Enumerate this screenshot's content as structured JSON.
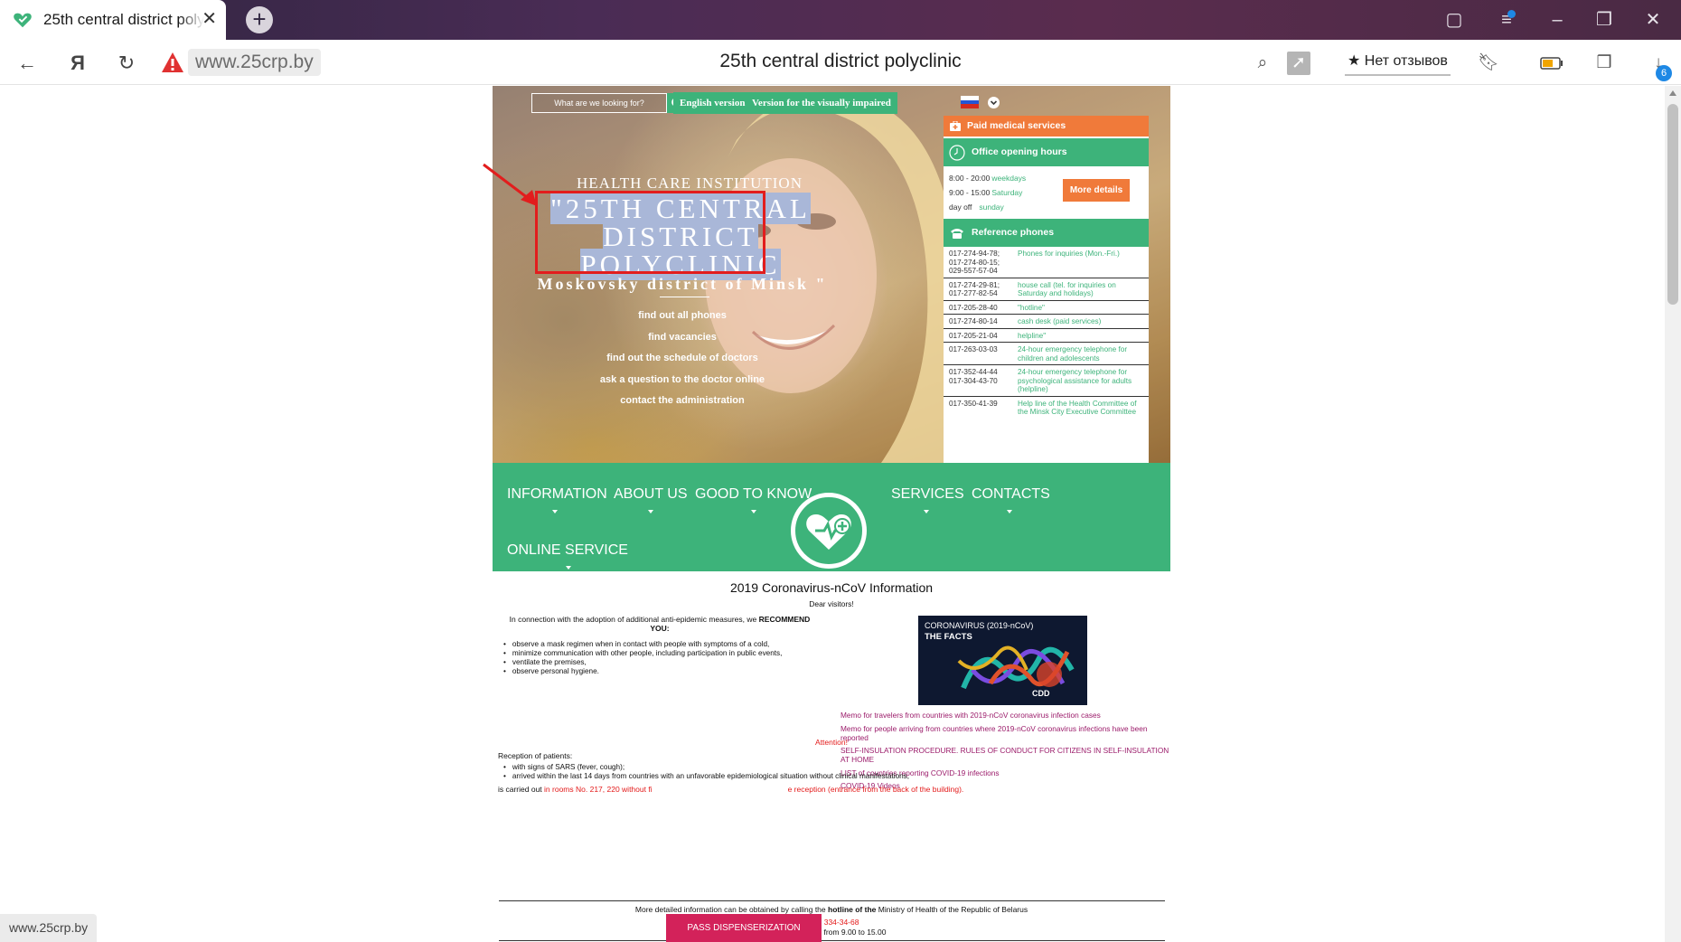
{
  "browser": {
    "tab_title": "25th central district polyclinic",
    "url": "www.25crp.by",
    "page_title": "25th central district polyclinic",
    "reviews_label": "Нет отзывов",
    "downloads_badge": "6",
    "status_url": "www.25crp.by"
  },
  "site": {
    "search_placeholder": "What are we looking for?",
    "english_btn": "English version",
    "visually_impaired_btn": "Version for the visually impaired",
    "hero": {
      "institution_label": "HEALTH CARE INSTITUTION",
      "name_line1": "\"25TH CENTRAL",
      "name_line2": "DISTRICT",
      "name_line3": "POLYCLINIC",
      "subname": "Moskovsky district of Minsk \"",
      "links": [
        "find out all phones",
        "find vacancies",
        "find out the schedule of doctors",
        "ask a question to the doctor online",
        "contact the administration"
      ]
    },
    "panel": {
      "paid_services": "Paid medical services",
      "office_hours_title": "Office opening hours",
      "hours": [
        {
          "time": "8:00 - 20:00",
          "label": "weekdays"
        },
        {
          "time": "9:00 - 15:00",
          "label": "Saturday"
        },
        {
          "time": "day off",
          "label": "sunday"
        }
      ],
      "more_details": "More details",
      "phones_title": "Reference phones",
      "phones": [
        {
          "num": "017-274-94-78;\n017-274-80-15;\n029-557-57-04",
          "desc": "Phones for inquiries (Mon.-Fri.)"
        },
        {
          "num": "017-274-29-81;\n017-277-82-54",
          "desc": "house call (tel. for inquiries on Saturday and holidays)"
        },
        {
          "num": "017-205-28-40",
          "desc": "\"hotline\""
        },
        {
          "num": "017-274-80-14",
          "desc": "cash desk (paid services)"
        },
        {
          "num": "017-205-21-04",
          "desc": "helpline\""
        },
        {
          "num": "017-263-03-03",
          "desc": "24-hour emergency telephone for children and adolescents"
        },
        {
          "num": "017-352-44-44\n017-304-43-70",
          "desc": "24-hour emergency telephone for psychological assistance for adults (helpline)"
        },
        {
          "num": "017-350-41-39",
          "desc": "Help line of the Health Committee of the Minsk City Executive Committee"
        }
      ]
    },
    "nav": {
      "information": "INFORMATION",
      "about_us": "ABOUT US",
      "good_to_know": "GOOD TO KNOW",
      "services": "SERVICES",
      "contacts": "CONTACTS",
      "online_service": "ONLINE SERVICE"
    },
    "content": {
      "title": "2019 Coronavirus-nCoV Information",
      "dear": "Dear visitors!",
      "para_pre": "In connection with the adoption of additional anti-epidemic measures, we",
      "para_bold": "RECOMMEND YOU:",
      "recommendations": [
        "observe a mask regimen when in contact with people with symptoms of a cold,",
        "minimize communication with other people, including participation in public events,",
        "ventilate the premises,",
        "observe personal hygiene."
      ],
      "image_line1": "CORONAVIRUS (2019-nCoV)",
      "image_line2": "THE FACTS",
      "image_logo": "CDD",
      "links": [
        "Memo for travelers from countries with 2019-nCoV coronavirus infection cases",
        "Memo for people arriving from countries where 2019-nCoV coronavirus infections have been reported",
        "SELF-INSULATION PROCEDURE. RULES OF CONDUCT FOR CITIZENS IN SELF-INSULATION AT HOME",
        "LIST of countries reporting COVID-19 infections",
        "COVID-19 Videos"
      ],
      "detail_pre": "More detailed information can be obtained by calling the",
      "detail_bold": "hotline of the",
      "detail_post": "Ministry of Health of the Republic of Belarus",
      "hotline_number": "(017) 334-34-68",
      "weekdays": "on weekdays from 9.00 to 15.00",
      "attention": "Attention!",
      "reception": "Reception of patients:",
      "reception_list": [
        "with signs of SARS (fever, cough);",
        "arrived within the last 14 days from countries with an unfavorable epidemiological situation without clinical manifestations,"
      ],
      "carried_pre": "is carried out",
      "carried_red1": "in rooms No. 217, 220 without fi",
      "carried_red2": "e reception (entrance from the back of the building).",
      "pass_btn": "PASS DISPENSERIZATION"
    }
  },
  "colors": {
    "green": "#3db37a",
    "orange": "#f07a3a",
    "link": "#9b1b6a",
    "red": "#e31919",
    "annotation": "#e21d1d"
  }
}
